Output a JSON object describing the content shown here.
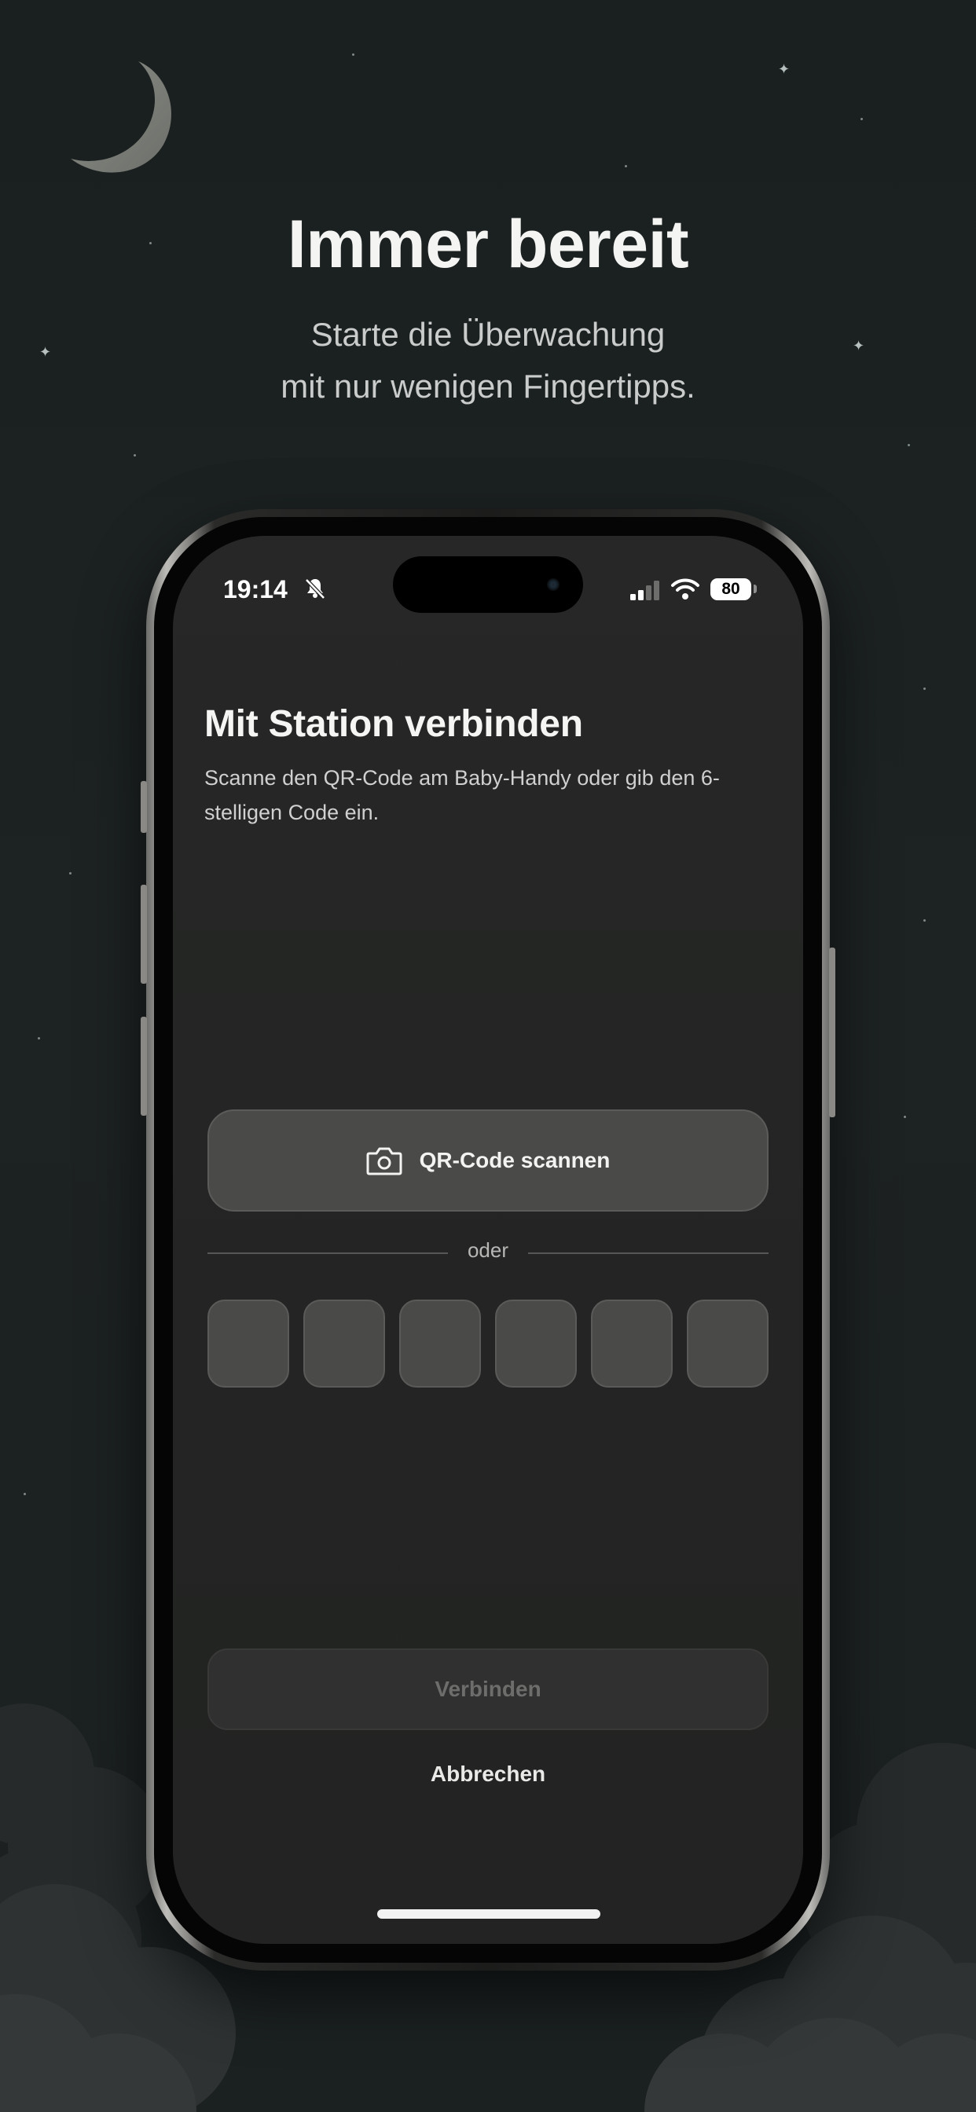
{
  "marketing": {
    "headline": "Immer bereit",
    "subline_1": "Starte die Überwachung",
    "subline_2": "mit nur wenigen Fingertipps."
  },
  "status_bar": {
    "time": "19:14",
    "battery": "80",
    "icons": [
      "bell-slash-icon",
      "cellular-signal-icon",
      "wifi-icon",
      "battery-icon"
    ]
  },
  "screen": {
    "title": "Mit Station verbinden",
    "description": "Scanne den QR-Code am Baby-Handy oder gib den 6-stelligen Code ein.",
    "scan_button_label": "QR-Code scannen",
    "divider_text": "oder",
    "code_boxes": [
      "",
      "",
      "",
      "",
      "",
      ""
    ],
    "connect_button_label": "Verbinden",
    "cancel_label": "Abbrechen"
  },
  "colors": {
    "background": "#1b2020",
    "screen_background": "#242524",
    "button_fill": "#4a4b49",
    "disabled_text": "#6d6e6c"
  }
}
